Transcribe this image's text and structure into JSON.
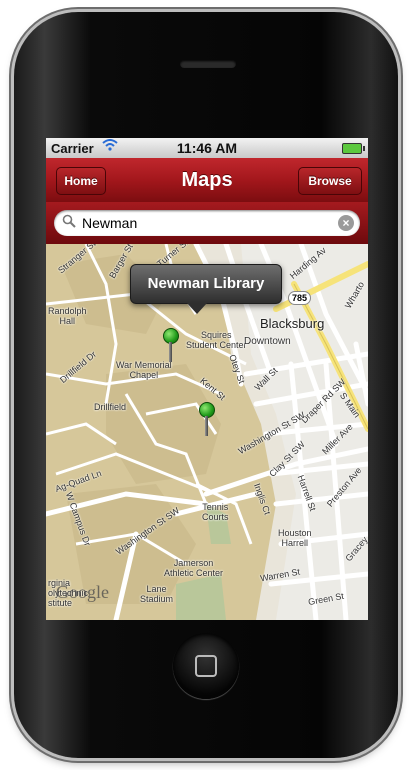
{
  "status_bar": {
    "carrier": "Carrier",
    "time": "11:46 AM",
    "wifi_icon": "wifi-icon",
    "battery_icon": "battery-icon"
  },
  "navbar": {
    "title": "Maps",
    "home_label": "Home",
    "browse_label": "Browse"
  },
  "search": {
    "value": "Newman",
    "icon": "magnifier-icon",
    "clear_icon": "clear-icon"
  },
  "map": {
    "callout": "Newman Library",
    "route_marker": "785",
    "attribution": "Google",
    "labels": {
      "stranger_st": "Stranger St",
      "barger_st": "Barger St",
      "turner_st": "Turner St",
      "harding_av": "Harding Av",
      "randolph_hall": "Randolph\nHall",
      "squires": "Squires\nStudent Center",
      "blacksburg": "Blacksburg",
      "downtown": "Downtown",
      "drillfield_dr": "Drillfield Dr",
      "war_memorial": "War Memorial\nChapel",
      "otey_st": "Otey St",
      "wall_st": "Wall St",
      "kent_st": "Kent St",
      "drillfield": "Drillfield",
      "washington_st_sw": "Washington St SW",
      "draper_rd_sw": "Draper Rd SW",
      "clay_st_sw": "Clay St SW",
      "miller_ave": "Miller Ave",
      "ag_quad_ln": "Ag-Quad Ln",
      "w_campus_dr": "W Campus Dr",
      "tennis_courts": "Tennis\nCourts",
      "preston_ave": "Preston Ave",
      "harrell_st": "Harrell St",
      "inglis_ct": "Inglis Ct",
      "houston_harrell": "Houston\nHarrell",
      "gracey": "Gracey",
      "jamerson": "Jamerson\nAthletic Center",
      "warren_st": "Warren St",
      "lane_stadium": "Lane\nStadium",
      "green_st": "Green St",
      "virginia_tech": "rginia\nolytechnic\nstitute",
      "washington_st_sw2": "Washington St SW",
      "s_main": "S Main",
      "wharton": "Wharto"
    }
  }
}
